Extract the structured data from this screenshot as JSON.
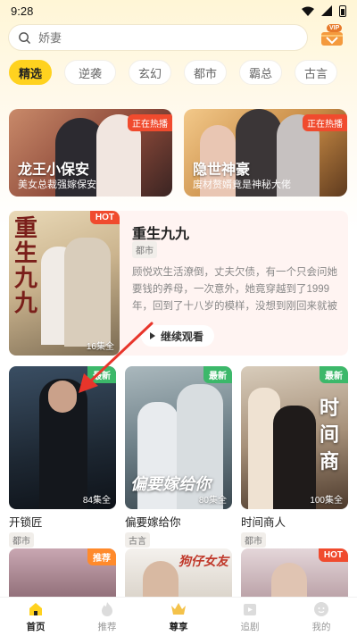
{
  "status_bar": {
    "time": "9:28"
  },
  "search": {
    "placeholder": "娇妻"
  },
  "vip": {
    "badge": "VIP"
  },
  "tabs": [
    {
      "label": "精选",
      "active": true
    },
    {
      "label": "逆袭"
    },
    {
      "label": "玄幻"
    },
    {
      "label": "都市"
    },
    {
      "label": "霸总"
    },
    {
      "label": "古言"
    }
  ],
  "banners": [
    {
      "tag": "正在热播",
      "title": "龙王小保安",
      "subtitle": "美女总裁强嫁保安"
    },
    {
      "tag": "正在热播",
      "title": "隐世神豪",
      "subtitle": "废材赘婿竟是神秘大佬"
    }
  ],
  "featured": {
    "tag": "HOT",
    "cover_text": "重生九九",
    "episodes": "16集全",
    "title": "重生九九",
    "genre": "都市",
    "description": "顾悦欢生活潦倒，丈夫欠债，有一个只会问她要钱的养母，一次意外，她竟穿越到了1999年，回到了十八岁的模样，没想到刚回来就被养母给卖...",
    "action": "继续观看"
  },
  "grid": [
    {
      "tag": "最新",
      "episodes": "84集全",
      "title": "开锁匠",
      "genre": "都市"
    },
    {
      "tag": "最新",
      "episodes": "80集全",
      "title": "偏要嫁给你",
      "genre": "古言",
      "cover_text": "偏要嫁给你"
    },
    {
      "tag": "最新",
      "episodes": "100集全",
      "title": "时间商人",
      "genre": "都市",
      "cover_text": "时间商"
    }
  ],
  "row2": [
    {
      "tag": "推荐"
    },
    {
      "tag": "",
      "cover_text": "狗仔女友"
    },
    {
      "tag": "HOT"
    }
  ],
  "bottom_nav": [
    {
      "label": "首页",
      "icon": "home-icon",
      "active": true
    },
    {
      "label": "推荐",
      "icon": "flame-icon"
    },
    {
      "label": "尊享",
      "icon": "crown-icon",
      "active_bold": true
    },
    {
      "label": "追剧",
      "icon": "play-box-icon"
    },
    {
      "label": "我的",
      "icon": "user-icon"
    }
  ],
  "colors": {
    "accent": "#ffd21f",
    "hot": "#f04b2e",
    "new": "#3cb86a",
    "recommend": "#ff8a2b"
  }
}
